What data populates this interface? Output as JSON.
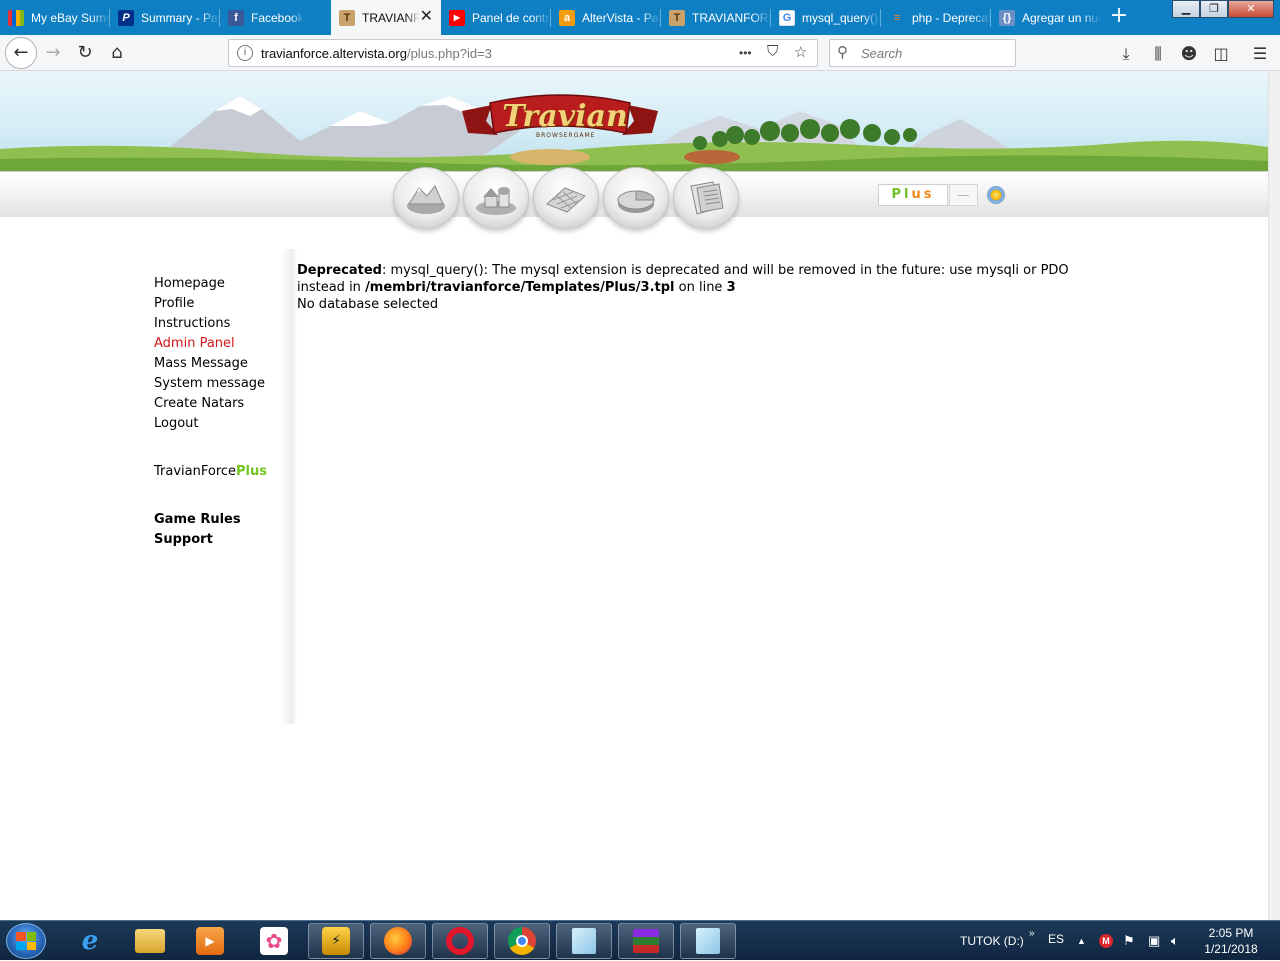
{
  "browser": {
    "tabs": [
      {
        "title": "My eBay Summary",
        "icon": "ebay-icon",
        "color": "#e53238"
      },
      {
        "title": "Summary - PayPal",
        "icon": "paypal-icon",
        "color": "#003087"
      },
      {
        "title": "Facebook",
        "icon": "facebook-icon",
        "color": "#3b5998"
      },
      {
        "title": "TRAVIANFORCE",
        "icon": "travian-icon",
        "color": "#8b5a2b"
      },
      {
        "title": "Panel de control",
        "icon": "youtube-icon",
        "color": "#ff0000"
      },
      {
        "title": "AlterVista - Pannello",
        "icon": "altervista-icon",
        "color": "#f39c12"
      },
      {
        "title": "TRAVIANFORCE",
        "icon": "travian-icon",
        "color": "#8b5a2b"
      },
      {
        "title": "mysql_query() - Google",
        "icon": "google-icon",
        "color": "#4285f4"
      },
      {
        "title": "php - Deprecated",
        "icon": "stackoverflow-icon",
        "color": "#f48024"
      },
      {
        "title": "Agregar un nuevo",
        "icon": "brackets-icon",
        "color": "#6a8fc4"
      }
    ],
    "url_host": "travianforce.altervista.org",
    "url_path": "/plus.php?id=3",
    "search_placeholder": "Search",
    "url_actions": {
      "more": "•••",
      "pocket": "pocket-icon",
      "bookmark": "☆"
    }
  },
  "site": {
    "logo_title": "Travian",
    "logo_subtitle": "BROWSERGAME",
    "plus_label_1": "Pl",
    "plus_label_2": "us",
    "plus_dash": "—"
  },
  "sidebar": {
    "items": [
      {
        "label": "Homepage"
      },
      {
        "label": "Profile"
      },
      {
        "label": "Instructions"
      },
      {
        "label": "Admin Panel"
      },
      {
        "label": "Mass Message"
      },
      {
        "label": "System message"
      },
      {
        "label": "Create Natars"
      },
      {
        "label": "Logout"
      }
    ],
    "plus_prefix": "TravianForce",
    "plus_suffix": "Plus",
    "footer": [
      {
        "label": "Game Rules"
      },
      {
        "label": "Support"
      }
    ]
  },
  "content": {
    "deprecated_label": "Deprecated",
    "message_part1": ": mysql_query(): The mysql extension is deprecated and will be removed in the future: use mysqli or PDO instead in ",
    "file_path": "/membri/travianforce/Templates/Plus/3.tpl",
    "on_line": " on line ",
    "line_number": "3",
    "error2": "No database selected"
  },
  "taskbar": {
    "tray_drive": "TUTOK (D:)",
    "tray_lang": "ES",
    "time": "2:05 PM",
    "date": "1/21/2018"
  },
  "colors": {
    "tabbar": "#0f7fc3",
    "admin_red": "#d01818",
    "plus_green": "#71c61e",
    "plus_orange": "#ef8a18"
  }
}
